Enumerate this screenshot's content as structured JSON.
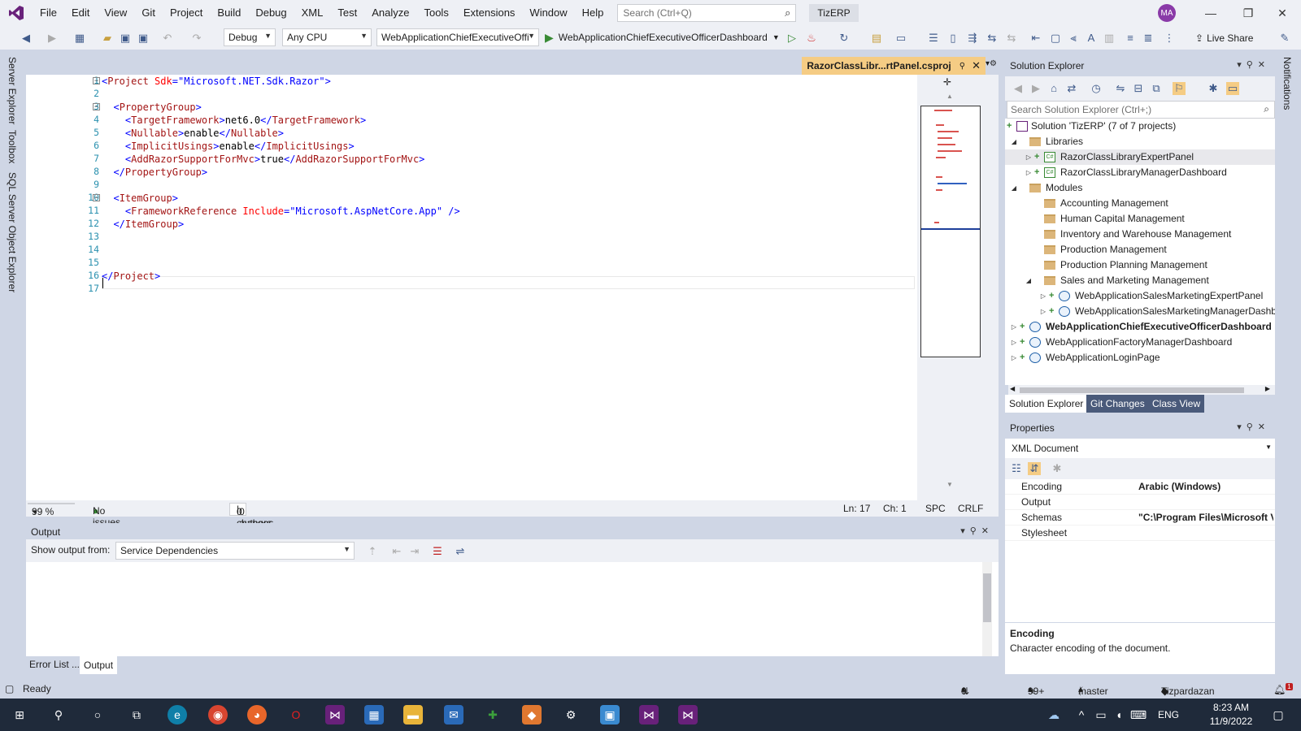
{
  "menu": {
    "items": [
      "File",
      "Edit",
      "View",
      "Git",
      "Project",
      "Build",
      "Debug",
      "XML",
      "Test",
      "Analyze",
      "Tools",
      "Extensions",
      "Window",
      "Help"
    ],
    "search_placeholder": "Search (Ctrl+Q)",
    "solution_badge": "TizERP",
    "avatar_initials": "MA"
  },
  "toolbar": {
    "config": "Debug",
    "platform": "Any CPU",
    "startup_project": "WebApplicationChiefExecutiveOffi",
    "run_target": "WebApplicationChiefExecutiveOfficerDashboard",
    "live_share": "Live Share"
  },
  "left_rail": [
    "Server Explorer",
    "Toolbox",
    "SQL Server Object Explorer"
  ],
  "right_rail": [
    "Notifications"
  ],
  "editor": {
    "tab_title": "RazorClassLibr...rtPanel.csproj",
    "zoom": "99 %",
    "issues": "No issues found",
    "changes": "0 changes",
    "authors": "0 authors, 0 changes",
    "line": "Ln: 17",
    "col": "Ch: 1",
    "spacing": "SPC",
    "eol": "CRLF",
    "line_numbers": [
      "1",
      "2",
      "3",
      "4",
      "5",
      "6",
      "7",
      "8",
      "9",
      "10",
      "11",
      "12",
      "13",
      "14",
      "15",
      "16",
      "17"
    ],
    "code": {
      "l1_tag": "Project",
      "l1_attr": "Sdk",
      "l1_val": "Microsoft.NET.Sdk.Razor",
      "l3_tag": "PropertyGroup",
      "l4_tag": "TargetFramework",
      "l4_val": "net6.0",
      "l5_tag": "Nullable",
      "l5_val": "enable",
      "l6_tag": "ImplicitUsings",
      "l6_val": "enable",
      "l7_tag": "AddRazorSupportForMvc",
      "l7_val": "true",
      "l10_tag": "ItemGroup",
      "l11_tag": "FrameworkReference",
      "l11_attr": "Include",
      "l11_val": "Microsoft.AspNetCore.App"
    }
  },
  "output": {
    "title": "Output",
    "show_from_label": "Show output from:",
    "source": "Service Dependencies"
  },
  "bottom_tabs": [
    "Error List ...",
    "Output"
  ],
  "solution_explorer": {
    "title": "Solution Explorer",
    "search_placeholder": "Search Solution Explorer (Ctrl+;)",
    "tree": [
      {
        "label": "Solution 'TizERP' (7 of 7 projects)"
      },
      {
        "label": "Libraries"
      },
      {
        "label": "RazorClassLibraryExpertPanel"
      },
      {
        "label": "RazorClassLibraryManagerDashboard"
      },
      {
        "label": "Modules"
      },
      {
        "label": "Accounting Management"
      },
      {
        "label": "Human Capital Management"
      },
      {
        "label": "Inventory and Warehouse Management"
      },
      {
        "label": "Production Management"
      },
      {
        "label": "Production Planning Management"
      },
      {
        "label": "Sales and Marketing Management"
      },
      {
        "label": "WebApplicationSalesMarketingExpertPanel"
      },
      {
        "label": "WebApplicationSalesMarketingManagerDashb"
      },
      {
        "label": "WebApplicationChiefExecutiveOfficerDashboard"
      },
      {
        "label": "WebApplicationFactoryManagerDashboard"
      },
      {
        "label": "WebApplicationLoginPage"
      }
    ],
    "tabs": [
      "Solution Explorer",
      "Git Changes",
      "Class View"
    ]
  },
  "properties": {
    "title": "Properties",
    "object": "XML Document",
    "rows": [
      {
        "name": "Encoding",
        "value": "Arabic (Windows)"
      },
      {
        "name": "Output",
        "value": ""
      },
      {
        "name": "Schemas",
        "value": "\"C:\\Program Files\\Microsoft V"
      },
      {
        "name": "Stylesheet",
        "value": ""
      }
    ],
    "desc_title": "Encoding",
    "desc_text": "Character encoding of the document."
  },
  "statusbar": {
    "ready": "Ready",
    "sync": "0 / 0",
    "edits": "99+",
    "branch": "master",
    "repo": "Tizpardazan Git",
    "notif_count": "1"
  },
  "taskbar": {
    "lang": "ENG",
    "time": "8:23 AM",
    "date": "11/9/2022"
  },
  "colors": {
    "accent": "#68217a",
    "tab_active": "#f5cc84",
    "chrome": "#cfd6e5",
    "taskbar": "#1f2a3a"
  }
}
